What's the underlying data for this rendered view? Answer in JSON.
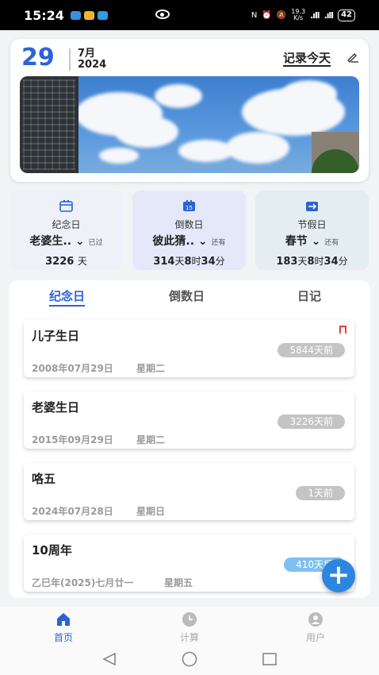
{
  "status_bar": {
    "time": "15:24",
    "speed": "19.3",
    "speed_unit": "K/s",
    "battery": "42"
  },
  "date_card": {
    "day": "29",
    "month": "7月",
    "year": "2024",
    "record_today": "记录今天"
  },
  "summary_cards": [
    {
      "label": "纪念日",
      "title": "老婆生..",
      "note": "已过",
      "value": "3226",
      "unit": "天",
      "bg": "#eef1f7",
      "icon_color": "#2c62d8"
    },
    {
      "label": "倒数日",
      "title": "彼此猜..",
      "note": "还有",
      "v1": "314",
      "v2": "8",
      "v3": "34",
      "bg": "#e4e8f8",
      "icon_color": "#2c62d8"
    },
    {
      "label": "节假日",
      "title": "春节",
      "note": "还有",
      "v1": "183",
      "v2": "8",
      "v3": "34",
      "bg": "#e4eef2",
      "icon_color": "#2c62d8"
    }
  ],
  "units": {
    "day": "天",
    "hour": "时",
    "minute": "分"
  },
  "tabs": [
    "纪念日",
    "倒数日",
    "日记"
  ],
  "events": [
    {
      "title": "儿子生日",
      "badge": "5844天前",
      "date": "2008年07月29日",
      "weekday": "星期二",
      "bookmarked": true
    },
    {
      "title": "老婆生日",
      "badge": "3226天前",
      "date": "2015年09月29日",
      "weekday": "星期二"
    },
    {
      "title": "咯五",
      "badge": "1天前",
      "date": "2024年07月28日",
      "weekday": "星期日"
    },
    {
      "title": "10周年",
      "badge": "410天后",
      "date": "乙巳年(2025)七月廿一",
      "weekday": "星期五"
    }
  ],
  "bottom_nav": [
    {
      "label": "首页",
      "active": true
    },
    {
      "label": "计算",
      "active": false
    },
    {
      "label": "用户",
      "active": false
    }
  ],
  "colors": {
    "accent": "#2c62d8",
    "fab": "#2c86e0",
    "badge_gray": "#c4c4c4",
    "badge_blue": "#7fc0f2"
  }
}
